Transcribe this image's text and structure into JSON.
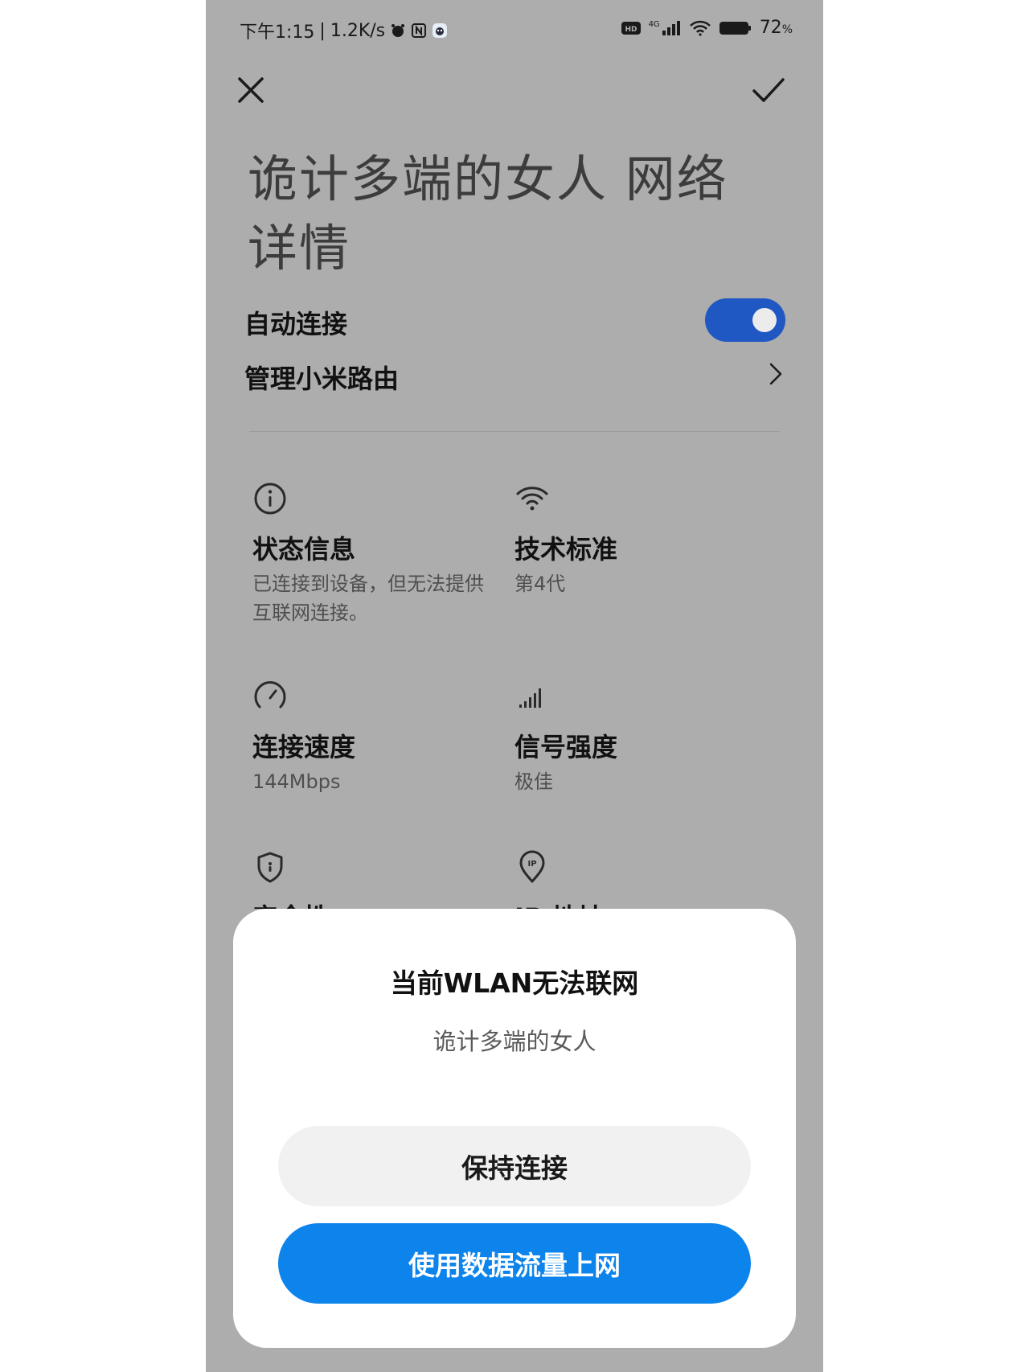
{
  "status_bar": {
    "time": "下午1:15",
    "separator": "|",
    "net_speed": "1.2K/s",
    "network_type": "4G",
    "hd_badge": "HD",
    "battery": "72",
    "battery_unit": "%"
  },
  "header": {
    "close_icon": "close-icon",
    "confirm_icon": "check-icon",
    "title": "诡计多端的女人 网络详情"
  },
  "settings": {
    "auto_connect_label": "自动连接",
    "auto_connect_on": true,
    "manage_router_label": "管理小米路由"
  },
  "details": [
    {
      "icon": "info-icon",
      "title": "状态信息",
      "value": "已连接到设备，但无法提供互联网连接。"
    },
    {
      "icon": "wifi-icon",
      "title": "技术标准",
      "value": "第4代"
    },
    {
      "icon": "speed-icon",
      "title": "连接速度",
      "value": "144Mbps"
    },
    {
      "icon": "signal-icon",
      "title": "信号强度",
      "value": "极佳"
    },
    {
      "icon": "shield-icon",
      "title": "安全性",
      "value": ""
    },
    {
      "icon": "ip-pin-icon",
      "title": "IP 地址",
      "value": ""
    }
  ],
  "dialog": {
    "title": "当前WLAN无法联网",
    "network_name": "诡计多端的女人",
    "keep_button": "保持连接",
    "use_data_button": "使用数据流量上网"
  },
  "colors": {
    "background_dim": "#adadad",
    "toggle_on": "#1f57c3",
    "primary_button": "#0d84ec",
    "secondary_button": "#f1f1f1"
  }
}
